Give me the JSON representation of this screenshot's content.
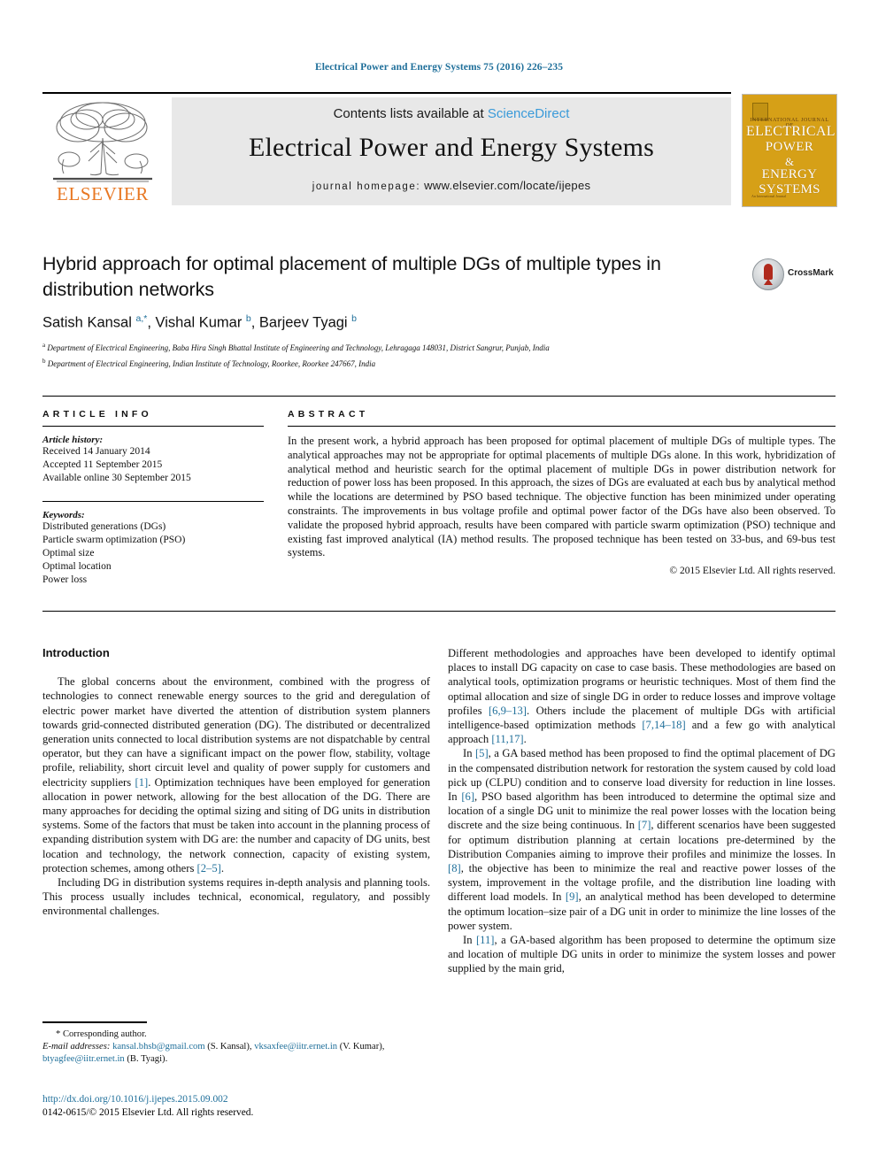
{
  "running_head": "Electrical Power and Energy Systems 75 (2016) 226–235",
  "masthead": {
    "publisher_name": "ELSEVIER",
    "contents_prefix": "Contents lists available at",
    "contents_link": "ScienceDirect",
    "journal_title": "Electrical Power and Energy Systems",
    "homepage_label": "journal homepage:",
    "homepage_url": "www.elsevier.com/locate/ijepes",
    "cover": {
      "kicker": "INTERNATIONAL JOURNAL OF",
      "line1": "ELECTRICAL",
      "line2": "POWER",
      "line3": "&",
      "line4": "ENERGY",
      "line5": "SYSTEMS",
      "footer": "An International Journal",
      "background_color": "#d6a017"
    }
  },
  "article": {
    "title": "Hybrid approach for optimal placement of multiple DGs of multiple types in distribution networks",
    "crossmark_label": "CrossMark",
    "authors_html": "Satish Kansal <sup>a,*</sup>, Vishal Kumar <sup>b</sup>, Barjeev Tyagi <sup>b</sup>",
    "affiliation_a": "Department of Electrical Engineering, Baba Hira Singh Bhattal Institute of Engineering and Technology, Lehragaga 148031, District Sangrur, Punjab, India",
    "affiliation_b": "Department of Electrical Engineering, Indian Institute of Technology, Roorkee, Roorkee 247667, India"
  },
  "article_info": {
    "heading": "ARTICLE INFO",
    "history_label": "Article history:",
    "history": [
      "Received 14 January 2014",
      "Accepted 11 September 2015",
      "Available online 30 September 2015"
    ],
    "keywords_label": "Keywords:",
    "keywords": [
      "Distributed generations (DGs)",
      "Particle swarm optimization (PSO)",
      "Optimal size",
      "Optimal location",
      "Power loss"
    ]
  },
  "abstract": {
    "heading": "ABSTRACT",
    "text": "In the present work, a hybrid approach has been proposed for optimal placement of multiple DGs of multiple types. The analytical approaches may not be appropriate for optimal placements of multiple DGs alone. In this work, hybridization of analytical method and heuristic search for the optimal placement of multiple DGs in power distribution network for reduction of power loss has been proposed. In this approach, the sizes of DGs are evaluated at each bus by analytical method while the locations are determined by PSO based technique. The objective function has been minimized under operating constraints. The improvements in bus voltage profile and optimal power factor of the DGs have also been observed. To validate the proposed hybrid approach, results have been compared with particle swarm optimization (PSO) technique and existing fast improved analytical (IA) method results. The proposed technique has been tested on 33-bus, and 69-bus test systems.",
    "copyright": "© 2015 Elsevier Ltd. All rights reserved."
  },
  "body": {
    "section_heading": "Introduction",
    "left_paragraph_1": "The global concerns about the environment, combined with the progress of technologies to connect renewable energy sources to the grid and deregulation of electric power market have diverted the attention of distribution system planners towards grid-connected distributed generation (DG). The distributed or decentralized generation units connected to local distribution systems are not dispatchable by central operator, but they can have a significant impact on the power flow, stability, voltage profile, reliability, short circuit level and quality of power supply for customers and electricity suppliers",
    "left_p1_ref_1": "[1]",
    "left_p1_cont": ". Optimization techniques have been employed for generation allocation in power network, allowing for the best allocation of the DG. There are many approaches for deciding the optimal sizing and siting of DG units in distribution systems. Some of the factors that must be taken into account in the planning process of expanding distribution system with DG are: the number and capacity of DG units, best location and technology, the network connection, capacity of existing system, protection schemes, among others",
    "left_p1_ref_2": "[2–5]",
    "left_p1_end": ".",
    "left_paragraph_2": "Including DG in distribution systems requires in-depth analysis and planning tools. This process usually includes technical, economical, regulatory, and possibly environmental challenges.",
    "right_paragraph_1a": "Different methodologies and approaches have been developed to identify optimal places to install DG capacity on case to case basis. These methodologies are based on analytical tools, optimization programs or heuristic techniques. Most of them find the optimal allocation and size of single DG in order to reduce losses and improve voltage profiles",
    "right_p1_ref1": "[6,9–13]",
    "right_paragraph_1b": ". Others include the placement of multiple DGs with artificial intelligence-based optimization methods",
    "right_p1_ref2": "[7,14–18]",
    "right_paragraph_1c": " and a few go with analytical approach",
    "right_p1_ref3": "[11,17]",
    "right_paragraph_1d": ".",
    "right_p2_lead": "In ",
    "right_p2_ref1": "[5]",
    "right_paragraph_2a": ", a GA based method has been proposed to find the optimal placement of DG in the compensated distribution network for restoration the system caused by cold load pick up (CLPU) condition and to conserve load diversity for reduction in line losses. In ",
    "right_p2_ref2": "[6]",
    "right_paragraph_2b": ", PSO based algorithm has been introduced to determine the optimal size and location of a single DG unit to minimize the real power losses with the location being discrete and the size being continuous. In ",
    "right_p2_ref3": "[7]",
    "right_paragraph_2c": ", different scenarios have been suggested for optimum distribution planning at certain locations pre-determined by the Distribution Companies aiming to improve their profiles and minimize the losses. In ",
    "right_p2_ref4": "[8]",
    "right_paragraph_2d": ", the objective has been to minimize the real and reactive power losses of the system, improvement in the voltage profile, and the distribution line loading with different load models. In ",
    "right_p2_ref5": "[9]",
    "right_paragraph_2e": ", an analytical method has been developed to determine the optimum location–size pair of a DG unit in order to minimize the line losses of the power system.",
    "right_p3_lead": "In ",
    "right_p3_ref1": "[11]",
    "right_paragraph_3": ", a GA-based algorithm has been proposed to determine the optimum size and location of multiple DG units in order to minimize the system losses and power supplied by the main grid,"
  },
  "footnote": {
    "corresponding": "* Corresponding author.",
    "email_label": "E-mail addresses:",
    "email_1": "kansal.bhsb@gmail.com",
    "email_1_owner": "(S. Kansal),",
    "email_2": "vksaxfee@iitr.ernet.in",
    "email_2_owner": "(V. Kumar),",
    "email_3": "btyagfee@iitr.ernet.in",
    "email_3_owner": "(B. Tyagi)."
  },
  "imprint": {
    "doi": "http://dx.doi.org/10.1016/j.ijepes.2015.09.002",
    "issn_line": "0142-0615/© 2015 Elsevier Ltd. All rights reserved."
  },
  "colors": {
    "link": "#1f6f9a",
    "science_direct": "#3a9ad9",
    "elsevier_orange": "#e87722",
    "band_gray": "#e8e8e8"
  }
}
